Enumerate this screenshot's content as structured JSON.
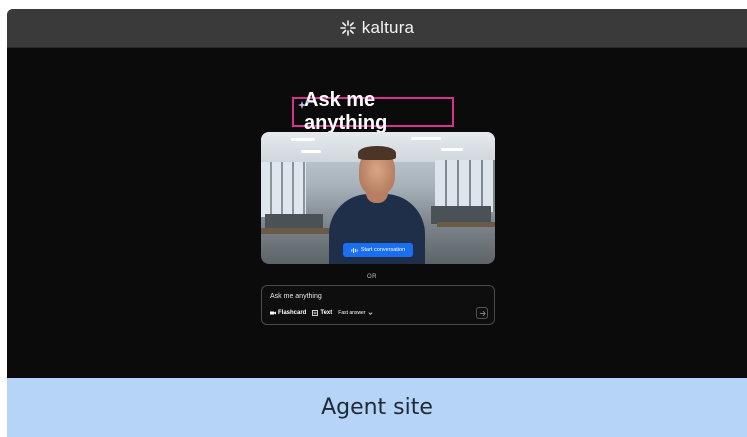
{
  "app": {
    "brand": "kaltura"
  },
  "hero": {
    "headline": "Ask me anything"
  },
  "video": {
    "start_label": "Start conversation"
  },
  "divider": {
    "or_label": "OR"
  },
  "ask": {
    "input_value": "Ask me anything",
    "flashcard_label": "Flashcard",
    "text_label": "Text",
    "mode_label": "Fast answer"
  },
  "caption": {
    "text": "Agent site"
  },
  "colors": {
    "accent": "#1a6ef0",
    "highlight": "#d6338d",
    "caption_bg": "#b5d4f7"
  }
}
